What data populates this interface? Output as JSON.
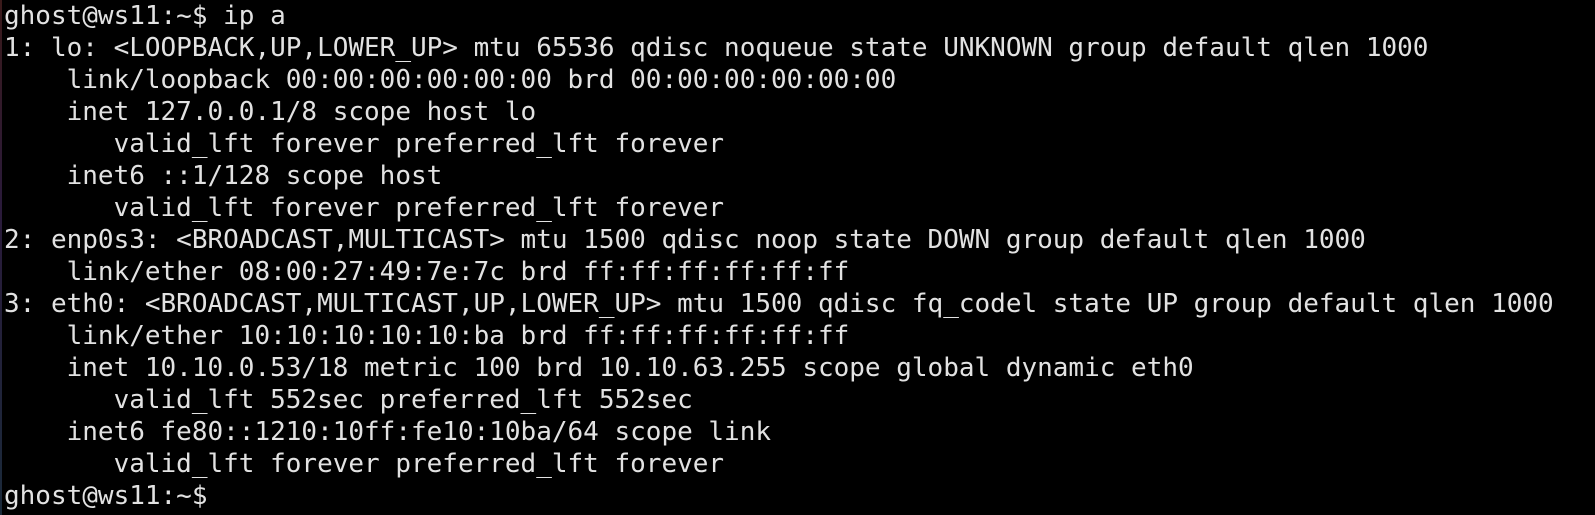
{
  "terminal": {
    "lines": [
      "ghost@ws11:~$ ip a",
      "1: lo: <LOOPBACK,UP,LOWER_UP> mtu 65536 qdisc noqueue state UNKNOWN group default qlen 1000",
      "    link/loopback 00:00:00:00:00:00 brd 00:00:00:00:00:00",
      "    inet 127.0.0.1/8 scope host lo",
      "       valid_lft forever preferred_lft forever",
      "    inet6 ::1/128 scope host",
      "       valid_lft forever preferred_lft forever",
      "2: enp0s3: <BROADCAST,MULTICAST> mtu 1500 qdisc noop state DOWN group default qlen 1000",
      "    link/ether 08:00:27:49:7e:7c brd ff:ff:ff:ff:ff:ff",
      "3: eth0: <BROADCAST,MULTICAST,UP,LOWER_UP> mtu 1500 qdisc fq_codel state UP group default qlen 1000",
      "    link/ether 10:10:10:10:10:ba brd ff:ff:ff:ff:ff:ff",
      "    inet 10.10.0.53/18 metric 100 brd 10.10.63.255 scope global dynamic eth0",
      "       valid_lft 552sec preferred_lft 552sec",
      "    inet6 fe80::1210:10ff:fe10:10ba/64 scope link",
      "       valid_lft forever preferred_lft forever",
      "ghost@ws11:~$"
    ]
  },
  "colors": {
    "background": "#000000",
    "foreground": "#e2e2e2"
  }
}
